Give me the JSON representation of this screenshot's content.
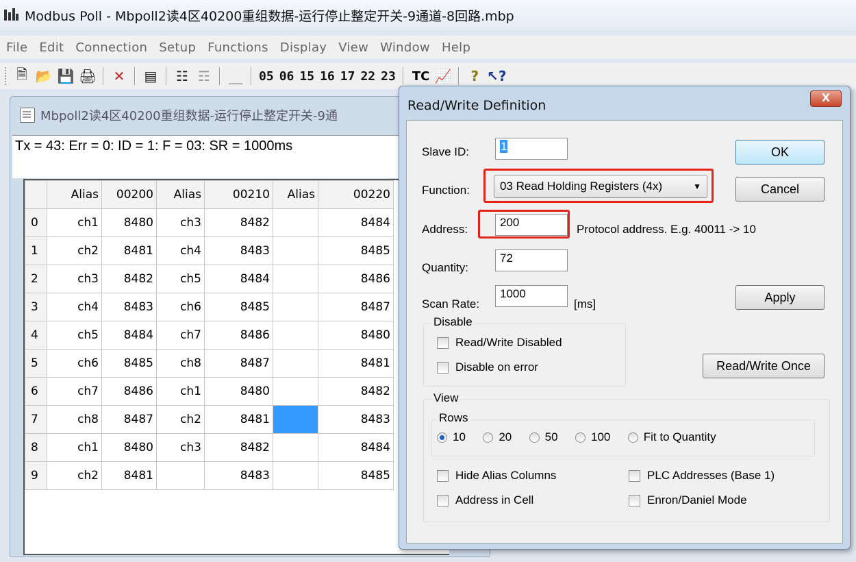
{
  "window": {
    "title": "Modbus Poll - Mbpoll2读4区40200重组数据-运行停止整定开关-9通道-8回路.mbp"
  },
  "menu": [
    "File",
    "Edit",
    "Connection",
    "Setup",
    "Functions",
    "Display",
    "View",
    "Window",
    "Help"
  ],
  "toolbar": {
    "codes": [
      "05",
      "06",
      "15",
      "16",
      "17",
      "22",
      "23"
    ],
    "tc_label": "TC"
  },
  "child": {
    "title": "Mbpoll2读4区40200重组数据-运行停止整定开关-9通",
    "status": "Tx = 43: Err = 0: ID = 1: F = 03: SR = 1000ms",
    "columns": [
      "Alias",
      "00200",
      "Alias",
      "00210",
      "Alias",
      "00220"
    ],
    "rows": [
      [
        "0",
        "ch1",
        "8480",
        "ch3",
        "8482",
        "",
        "8484"
      ],
      [
        "1",
        "ch2",
        "8481",
        "ch4",
        "8483",
        "",
        "8485"
      ],
      [
        "2",
        "ch3",
        "8482",
        "ch5",
        "8484",
        "",
        "8486"
      ],
      [
        "3",
        "ch4",
        "8483",
        "ch6",
        "8485",
        "",
        "8487"
      ],
      [
        "4",
        "ch5",
        "8484",
        "ch7",
        "8486",
        "",
        "8480"
      ],
      [
        "5",
        "ch6",
        "8485",
        "ch8",
        "8487",
        "",
        "8481"
      ],
      [
        "6",
        "ch7",
        "8486",
        "ch1",
        "8480",
        "",
        "8482"
      ],
      [
        "7",
        "ch8",
        "8487",
        "ch2",
        "8481",
        "",
        "8483"
      ],
      [
        "8",
        "ch1",
        "8480",
        "ch3",
        "8482",
        "",
        "8484"
      ],
      [
        "9",
        "ch2",
        "8481",
        "",
        "8483",
        "",
        "8485"
      ]
    ]
  },
  "dialog": {
    "title": "Read/Write Definition",
    "close_label": "X",
    "slave_id_label": "Slave ID:",
    "slave_id_value": "1",
    "function_label": "Function:",
    "function_value": "03 Read Holding Registers (4x)",
    "address_label": "Address:",
    "address_value": "200",
    "address_hint": "Protocol address. E.g. 40011 -> 10",
    "quantity_label": "Quantity:",
    "quantity_value": "72",
    "scan_rate_label": "Scan Rate:",
    "scan_rate_value": "1000",
    "scan_rate_unit": "[ms]",
    "ok_label": "OK",
    "cancel_label": "Cancel",
    "apply_label": "Apply",
    "read_write_once_label": "Read/Write Once",
    "disable_group": "Disable",
    "rw_disabled": "Read/Write Disabled",
    "disable_on_error": "Disable on error",
    "view_group": "View",
    "rows_group": "Rows",
    "rows_options": [
      "10",
      "20",
      "50",
      "100",
      "Fit to Quantity"
    ],
    "hide_alias": "Hide Alias Columns",
    "address_in_cell": "Address in Cell",
    "plc_addresses": "PLC Addresses (Base 1)",
    "enron_mode": "Enron/Daniel Mode"
  },
  "colors": {
    "highlight": "#e2231a",
    "selection": "#3399ff"
  }
}
